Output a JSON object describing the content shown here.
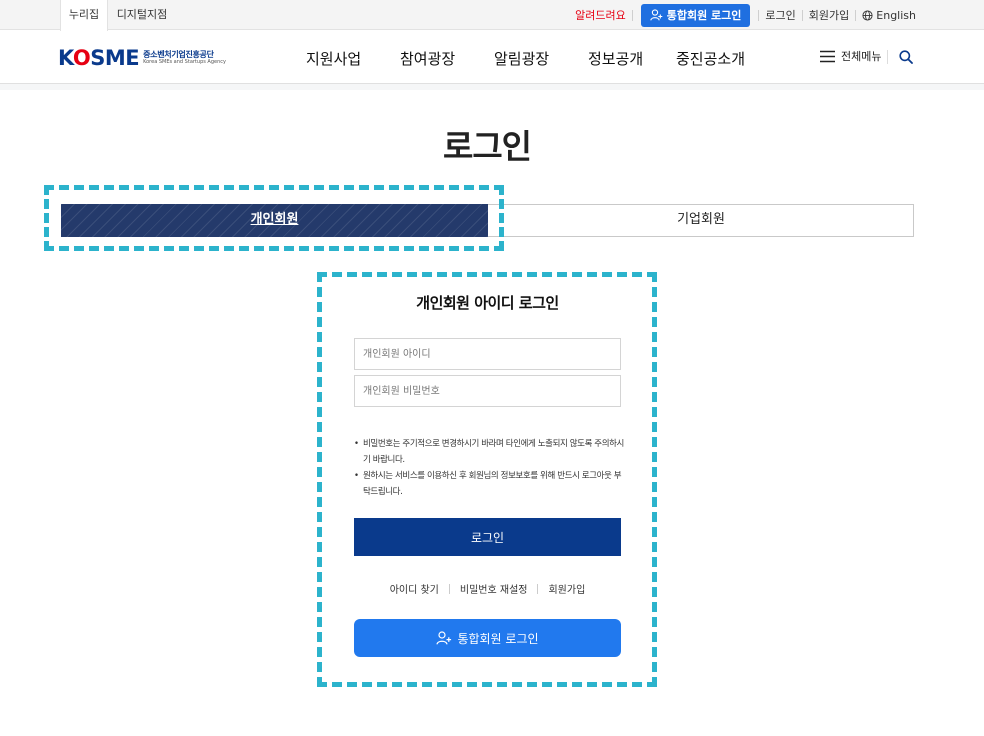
{
  "utility": {
    "tabs": [
      "누리집",
      "디지털지점"
    ],
    "alert_label": "알려드려요",
    "unified_login_label": "통합회원 로그인",
    "login_label": "로그인",
    "join_label": "회원가입",
    "english_label": "English"
  },
  "header": {
    "logo_mark_k": "K",
    "logo_mark_o": "O",
    "logo_mark_rest": "SME",
    "logo_korean": "중소벤처기업진흥공단",
    "logo_english": "Korea SMEs and Startups Agency",
    "nav": [
      "지원사업",
      "참여광장",
      "알림광장",
      "정보공개",
      "중진공소개"
    ],
    "all_menu_label": "전체메뉴"
  },
  "page": {
    "title": "로그인",
    "tabs": [
      {
        "label": "개인회원",
        "selected": true
      },
      {
        "label": "기업회원",
        "selected": false
      }
    ]
  },
  "login": {
    "title": "개인회원 아이디 로그인",
    "id_placeholder": "개인회원 아이디",
    "pw_placeholder": "개인회원 비밀번호",
    "notices": [
      "비밀번호는 주기적으로 변경하시기 바라며 타인에게 노출되지 않도록 주의하시기 바랍니다.",
      "원하시는 서비스를 이용하신 후 회원님의 정보보호를 위해 반드시 로그아웃 부탁드립니다."
    ],
    "login_button": "로그인",
    "links": [
      "아이디 찾기",
      "비밀번호 재설정",
      "회원가입"
    ],
    "unified_button": "통합회원 로그인"
  },
  "colors": {
    "brand_navy": "#0a3a8c",
    "unified_blue": "#2179ee",
    "alert_red": "#e60012",
    "highlight_cyan": "#2cb3cc"
  }
}
